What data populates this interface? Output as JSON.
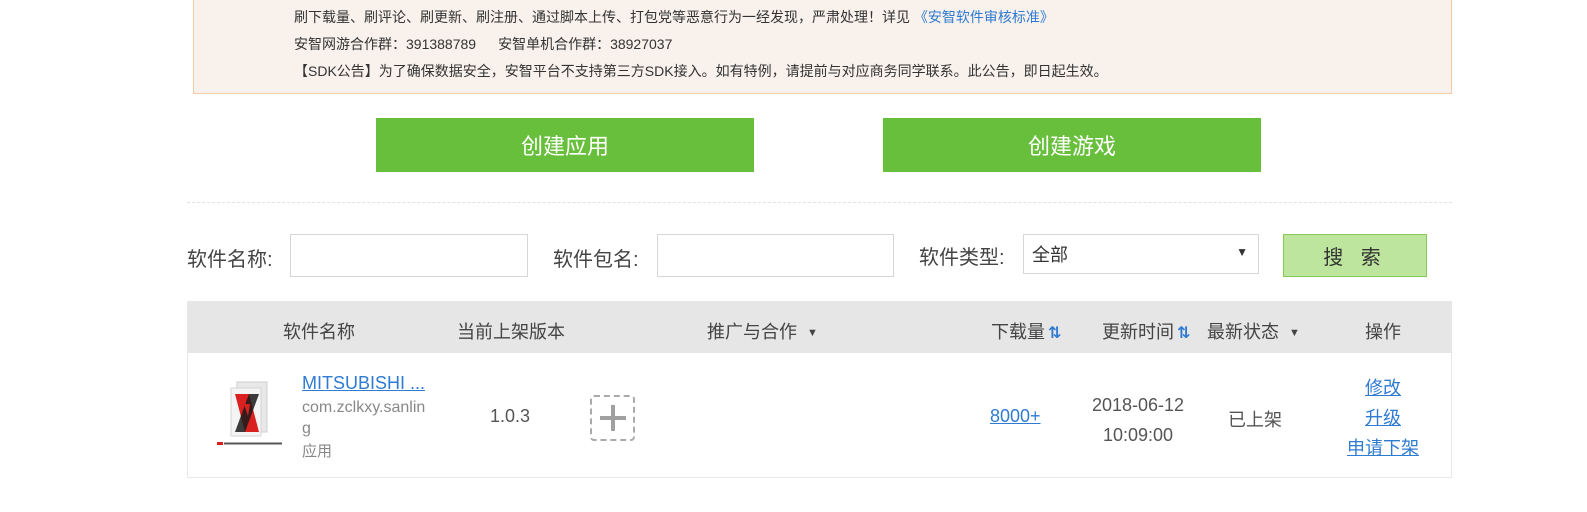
{
  "notice": {
    "line1_text": "刷下载量、刷评论、刷更新、刷注册、通过脚本上传、打包党等恶意行为一经发现，严肃处理！详见",
    "line1_link": "《安智软件审核标准》",
    "line2_part1": "安智网游合作群：391388789",
    "line2_part2": "安智单机合作群：38927037",
    "line3": "【SDK公告】为了确保数据安全，安智平台不支持第三方SDK接入。如有特例，请提前与对应商务同学联系。此公告，即日起生效。"
  },
  "actions": {
    "create_app": "创建应用",
    "create_game": "创建游戏"
  },
  "filters": {
    "name_label": "软件名称:",
    "name_value": "",
    "pkg_label": "软件包名:",
    "pkg_value": "",
    "type_label": "软件类型:",
    "type_value": "全部",
    "search": "搜 索"
  },
  "table": {
    "headers": {
      "name": "软件名称",
      "version": "当前上架版本",
      "promo": "推广与合作",
      "downloads": "下载量",
      "updated": "更新时间",
      "status": "最新状态",
      "ops": "操作"
    },
    "rows": [
      {
        "name": "MITSUBISHI ...",
        "package": "com.zclkxy.sanling",
        "type": "应用",
        "version": "1.0.3",
        "downloads": "8000+",
        "date": "2018-06-12",
        "time": "10:09:00",
        "status": "已上架",
        "op_edit": "修改",
        "op_upgrade": "升级",
        "op_delist": "申请下架"
      }
    ]
  },
  "colors": {
    "accent_green": "#67bf3b",
    "link_blue": "#2f7bd1",
    "search_green": "#bde59e"
  }
}
